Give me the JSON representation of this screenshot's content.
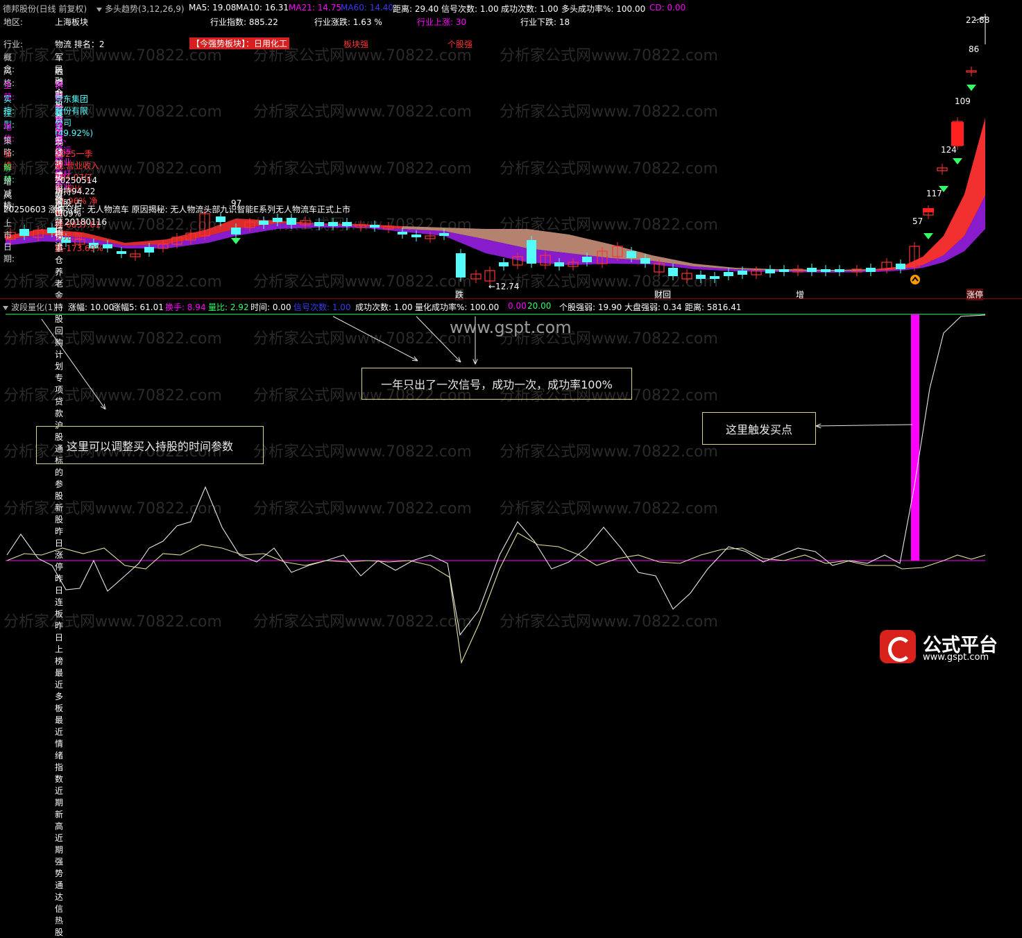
{
  "topbar": {
    "stock": "德邦股份(日线 前复权)",
    "formula": "多头趋势(3,12,26,9)",
    "ma5": "MA5: 19.08",
    "ma10": "MA10: 16.31",
    "ma21": "MA21: 14.75",
    "ma60": "MA60: 14.40",
    "dist": "距离: 29.40",
    "signals": "信号次数: 1.00",
    "success": "成功次数: 1.00",
    "rate": "多头成功率%: 100.00",
    "cd": "CD: 0.00"
  },
  "info": {
    "region_lbl": "地区:",
    "region": "上海板块",
    "idx": "行业指数: 885.22",
    "chg": "行业涨跌: 1.63 %",
    "up": "行业上涨: 30",
    "down": "行业下跌: 18",
    "industry_lbl": "行业:",
    "industry": "物流 排名：2",
    "strong": "【今强势板块】：日用化工",
    "sector_strong": "板块强",
    "stock_strong": "个股强",
    "concept_lbl": "概念:",
    "concept": "军民融合 机器人概念 跨境电商 冷链物流",
    "style_lbl": "风格:",
    "style": "融资融券 自由现金流 股东增持 社保重仓 养老金持股 回购计划 专项贷款 沪股通标的 参股新股 昨日涨停 昨日连板 昨日上榜 最近多板 最近情绪指数 近期新高 近期强势 通达信热股",
    "main_lbl": "主营:",
    "main": "供应链服务,公路货运",
    "ctrl_lbl": "实控:",
    "ctrl": "京东集团股份有限公司(49.92%)",
    "type_lbl": "控型:",
    "type": "其它",
    "pos_lbl": "地位:",
    "pos": "快递、快运行业标杆企业",
    "strat_lbl": "策略:",
    "strat": "三线开花",
    "perf_lbl": "业绩:",
    "perf": "2025一季报:营业收入104.07亿元,同比11.96% 净利润-6837.61万元,同比-173.69%",
    "unlock_lbl": "解禁:",
    "hold_lbl": "增减持:",
    "hold": "20250514增持94.22万股,占0.09%",
    "risk_lbl": "风险:",
    "risk": "财报亏损",
    "analysis": "20250603 涨停分析: 无人物流车 原因揭秘: 无人物流头部九识智能E系列无人物流车正式上市",
    "list_lbl": "上市日期:",
    "list": "20180116"
  },
  "chart_labels": {
    "p2288": "22.88",
    "p86": "86",
    "p109": "109",
    "p124": "124",
    "p117": "117",
    "p57": "57",
    "p97": "97",
    "low": "←12.74",
    "die": "跌",
    "caihui": "财回",
    "zeng": "增",
    "zhangting": "涨停"
  },
  "indbar": {
    "name": "波段量化(1)",
    "zf": "涨幅: 10.00",
    "zf5": "涨幅5: 61.01",
    "hs": "换手: 8.94",
    "lb": "量比: 2.92",
    "sj": "时间: 0.00",
    "xh": "信号次数: 1.00",
    "cg": "成功次数: 1.00",
    "lh": "量化成功率%: 100.00",
    "v0": "0.00",
    "v20": "20.00",
    "gg": "个股强弱: 19.90",
    "dp": "大盘强弱: 0.34",
    "jl": "距离: 5816.41"
  },
  "callouts": {
    "one": "这里可以调整买入持股的时间参数",
    "two": "一年只出了一次信号，成功一次，成功率100%",
    "three": "这里触发买点"
  },
  "watermarks": {
    "site": "分析家公式网www.70822.com",
    "gspt": "www.gspt.com"
  },
  "logo": {
    "t1": "公式平台",
    "t2": "www.gspt.com"
  },
  "colors": {
    "red": "#ff3333",
    "magenta": "#ff00ff",
    "cyan": "#54fcfc",
    "purple": "#a020f0",
    "brown": "#c8907a"
  }
}
